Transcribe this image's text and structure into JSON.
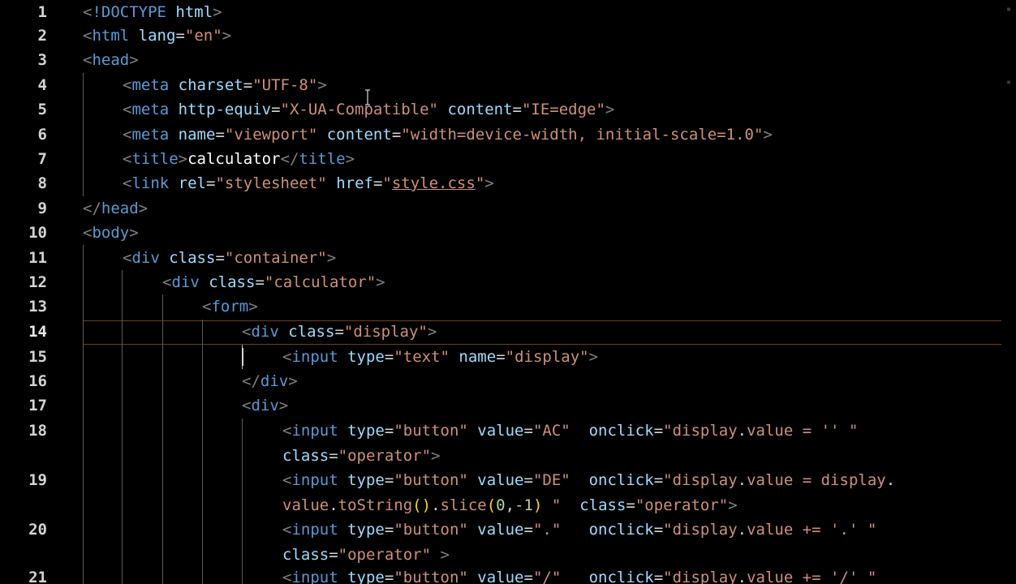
{
  "editor": {
    "colors": {
      "background": "#000000",
      "tag": "#569cd6",
      "attribute": "#9cdcfe",
      "string": "#ce9178",
      "current_line_border": "#6b3f1e"
    },
    "line_numbers": [
      "1",
      "2",
      "3",
      "4",
      "5",
      "6",
      "7",
      "8",
      "9",
      "10",
      "11",
      "12",
      "13",
      "14",
      "15",
      "16",
      "17",
      "18",
      "19",
      "20",
      "21"
    ],
    "current_line": "14",
    "lines": {
      "l1": {
        "lt": "<",
        "tag": "!DOCTYPE",
        "attr": "html",
        "gt": ">"
      },
      "l2": {
        "lt": "<",
        "tag": "html",
        "attr": "lang",
        "eq": "=",
        "val": "\"en\"",
        "gt": ">"
      },
      "l3": {
        "lt": "<",
        "tag": "head",
        "gt": ">"
      },
      "l4": {
        "lt": "<",
        "tag": "meta",
        "attr": "charset",
        "eq": "=",
        "val": "\"UTF-8\"",
        "gt": ">"
      },
      "l5": {
        "lt": "<",
        "tag": "meta",
        "a1": "http-equiv",
        "eq1": "=",
        "v1": "\"X-UA-Compatible\"",
        "a2": "content",
        "eq2": "=",
        "v2": "\"IE=edge\"",
        "gt": ">"
      },
      "l6": {
        "lt": "<",
        "tag": "meta",
        "a1": "name",
        "eq1": "=",
        "v1": "\"viewport\"",
        "a2": "content",
        "eq2": "=",
        "v2": "\"width=device-width, initial-scale=1.0\"",
        "gt": ">"
      },
      "l7": {
        "lt": "<",
        "tag": "title",
        "gt": ">",
        "text": "calculator",
        "lt2": "</",
        "tag2": "title",
        "gt2": ">"
      },
      "l8": {
        "lt": "<",
        "tag": "link",
        "a1": "rel",
        "eq1": "=",
        "v1": "\"stylesheet\"",
        "a2": "href",
        "eq2": "=",
        "q1": "\"",
        "link": "style.css",
        "q2": "\"",
        "gt": ">"
      },
      "l9": {
        "lt": "</",
        "tag": "head",
        "gt": ">"
      },
      "l10": {
        "lt": "<",
        "tag": "body",
        "gt": ">"
      },
      "l11": {
        "lt": "<",
        "tag": "div",
        "attr": "class",
        "eq": "=",
        "val": "\"container\"",
        "gt": ">"
      },
      "l12": {
        "lt": "<",
        "tag": "div",
        "attr": "class",
        "eq": "=",
        "val": "\"calculator\"",
        "gt": ">"
      },
      "l13": {
        "lt": "<",
        "tag": "form",
        "gt": ">"
      },
      "l14": {
        "lt": "<",
        "tag": "div",
        "attr": "class",
        "eq": "=",
        "val": "\"display\"",
        "gt": ">"
      },
      "l15": {
        "lt": "<",
        "tag": "input",
        "a1": "type",
        "eq1": "=",
        "v1": "\"text\"",
        "a2": "name",
        "eq2": "=",
        "v2": "\"display\"",
        "gt": ">"
      },
      "l16": {
        "lt": "</",
        "tag": "div",
        "gt": ">"
      },
      "l17": {
        "lt": "<",
        "tag": "div",
        "gt": ">"
      },
      "l18a": {
        "lt": "<",
        "tag": "input",
        "a1": "type",
        "eq1": "=",
        "v1": "\"button\"",
        "a2": "value",
        "eq2": "=",
        "v2": "\"AC\"",
        "a3": "onclick",
        "eq3": "=",
        "v3a": "\"display",
        "dot": ".",
        "v3b": "value = '' \""
      },
      "l18b": {
        "attr": "class",
        "eq": "=",
        "val": "\"operator\"",
        "gt": ">"
      },
      "l19a": {
        "lt": "<",
        "tag": "input",
        "a1": "type",
        "eq1": "=",
        "v1": "\"button\"",
        "a2": "value",
        "eq2": "=",
        "v2": "\"DE\"",
        "a3": "onclick",
        "eq3": "=",
        "v3a": "\"display",
        "dot": ".",
        "v3b": "value = display",
        "dot2": "."
      },
      "l19b": {
        "p1": "value",
        "dot1": ".",
        "fn1": "toString",
        "par1": "()",
        "dot2": ".",
        "fn2": "slice",
        "par2": "(",
        "n1": "0",
        "comma": ",",
        "n2": "-1",
        "par3": ")",
        "rest": " \"",
        "a": "class",
        "eq": "=",
        "val": "\"operator\"",
        "gt": ">"
      },
      "l20a": {
        "lt": "<",
        "tag": "input",
        "a1": "type",
        "eq1": "=",
        "v1": "\"button\"",
        "a2": "value",
        "eq2": "=",
        "v2": "\".\"",
        "a3": "onclick",
        "eq3": "=",
        "v3a": "\"display",
        "dot": ".",
        "v3b": "value += '.' \""
      },
      "l20b": {
        "attr": "class",
        "eq": "=",
        "val": "\"operator\"",
        "gt": " >"
      },
      "l21": {
        "lt": "<",
        "tag": "input",
        "a1": "type",
        "eq1": "=",
        "v1": "\"button\"",
        "a2": "value",
        "eq2": "=",
        "v2": "\"/\"",
        "a3": "onclick",
        "eq3": "=",
        "v3a": "\"display",
        "dot": ".",
        "v3b": "value += '/' \""
      }
    }
  }
}
